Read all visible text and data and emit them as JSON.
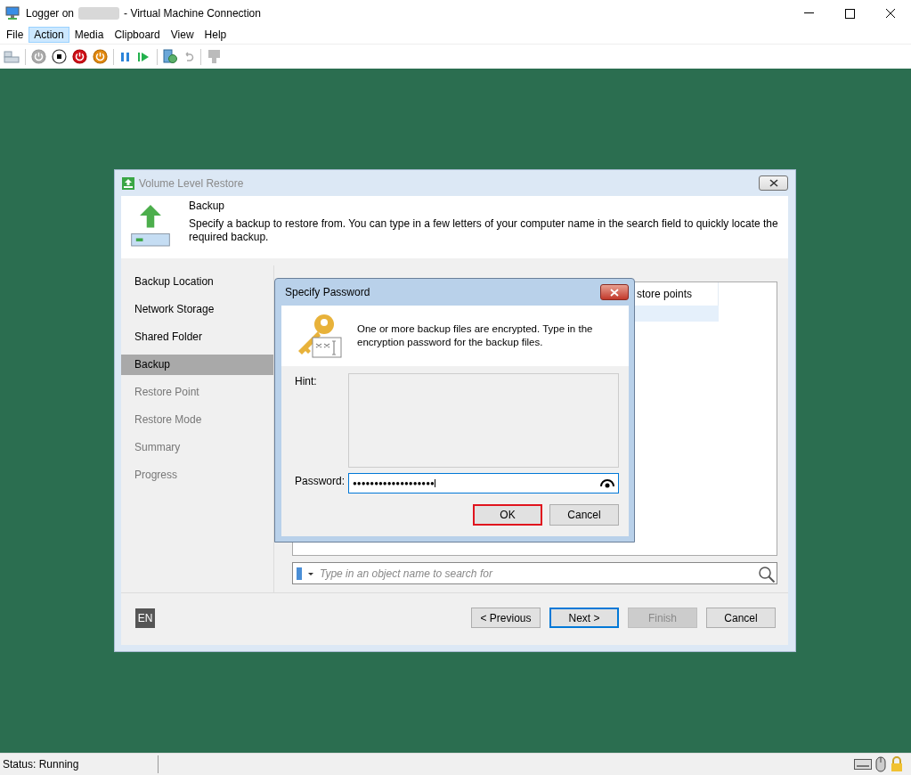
{
  "window": {
    "title_prefix": "Logger on",
    "title_suffix": "- Virtual Machine Connection"
  },
  "menu": [
    {
      "label": "File",
      "selected": false
    },
    {
      "label": "Action",
      "selected": true
    },
    {
      "label": "Media",
      "selected": false
    },
    {
      "label": "Clipboard",
      "selected": false
    },
    {
      "label": "View",
      "selected": false
    },
    {
      "label": "Help",
      "selected": false
    }
  ],
  "wizard": {
    "title": "Volume Level Restore",
    "step_title": "Backup",
    "step_description": "Specify a backup to restore from. You can type in a few letters of your computer name in the search field to quickly locate the required backup.",
    "steps": [
      {
        "label": "Backup Location",
        "selected": false,
        "disabled": false
      },
      {
        "label": "Network Storage",
        "selected": false,
        "disabled": false
      },
      {
        "label": "Shared Folder",
        "selected": false,
        "disabled": false
      },
      {
        "label": "Backup",
        "selected": true,
        "disabled": false
      },
      {
        "label": "Restore Point",
        "selected": false,
        "disabled": true
      },
      {
        "label": "Restore Mode",
        "selected": false,
        "disabled": true
      },
      {
        "label": "Summary",
        "selected": false,
        "disabled": true
      },
      {
        "label": "Progress",
        "selected": false,
        "disabled": true
      }
    ],
    "table_header": "store points",
    "search": {
      "placeholder": "Type in an object name to search for"
    },
    "language": "EN",
    "buttons": [
      {
        "label": "< Previous",
        "focused": false,
        "disabled": false
      },
      {
        "label": "Next >",
        "focused": true,
        "disabled": false
      },
      {
        "label": "Finish",
        "focused": false,
        "disabled": true
      },
      {
        "label": "Cancel",
        "focused": false,
        "disabled": false
      }
    ]
  },
  "dialog": {
    "title": "Specify Password",
    "message": "One or more backup files are encrypted. Type in the encryption password for the backup files.",
    "hint_label": "Hint:",
    "password_label": "Password:",
    "password": "●●●●●●●●●●●●●●●●●●●",
    "buttons": [
      {
        "label": "OK",
        "highlighted": true
      },
      {
        "label": "Cancel",
        "highlighted": false
      }
    ]
  },
  "status_bar": {
    "text": "Status: Running"
  }
}
